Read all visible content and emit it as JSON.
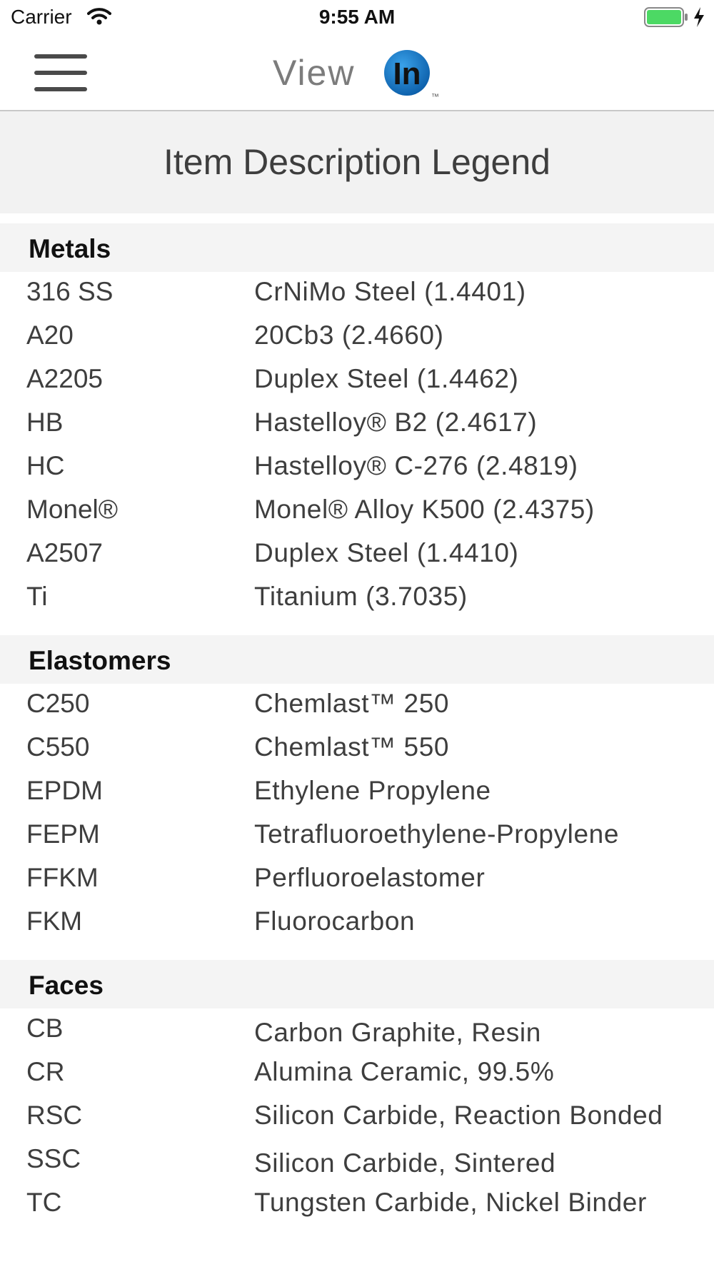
{
  "status_bar": {
    "carrier": "Carrier",
    "time": "9:55 AM",
    "icons": [
      "wifi-icon",
      "battery-icon",
      "charging-icon"
    ],
    "battery_color": "#4cd964"
  },
  "header": {
    "logo_text_1": "View",
    "logo_text_2": "In",
    "logo_tm": "™",
    "menu_icon": "hamburger-menu-icon",
    "brand_blue": "#1476c6"
  },
  "page": {
    "title": "Item Description Legend"
  },
  "sections": [
    {
      "title": "Metals",
      "rows": [
        {
          "code": "316 SS",
          "description": "CrNiMo Steel (1.4401)"
        },
        {
          "code": "A20",
          "description": "20Cb3 (2.4660)"
        },
        {
          "code": "A2205",
          "description": "Duplex Steel (1.4462)"
        },
        {
          "code": "HB",
          "description": "Hastelloy® B2 (2.4617)"
        },
        {
          "code": "HC",
          "description": "Hastelloy® C-276 (2.4819)"
        },
        {
          "code": "Monel®",
          "description": "Monel® Alloy K500 (2.4375)"
        },
        {
          "code": "A2507",
          "description": "Duplex Steel (1.4410)"
        },
        {
          "code": "Ti",
          "description": "Titanium (3.7035)"
        }
      ]
    },
    {
      "title": "Elastomers",
      "rows": [
        {
          "code": "C250",
          "description": "Chemlast™ 250"
        },
        {
          "code": "C550",
          "description": "Chemlast™ 550"
        },
        {
          "code": "EPDM",
          "description": "Ethylene Propylene"
        },
        {
          "code": "FEPM",
          "description": "Tetrafluoroethylene-Propylene"
        },
        {
          "code": "FFKM",
          "description": "Perfluoroelastomer"
        },
        {
          "code": "FKM",
          "description": "Fluorocarbon"
        }
      ]
    },
    {
      "title": "Faces",
      "rows": [
        {
          "code": "CB",
          "description": "Carbon Graphite, Resin"
        },
        {
          "code": "CR",
          "description": "Alumina Ceramic, 99.5%"
        },
        {
          "code": "RSC",
          "description": "Silicon Carbide, Reaction Bonded"
        },
        {
          "code": "SSC",
          "description": "Silicon Carbide, Sintered"
        },
        {
          "code": "TC",
          "description": "Tungsten Carbide, Nickel Binder"
        }
      ]
    }
  ]
}
